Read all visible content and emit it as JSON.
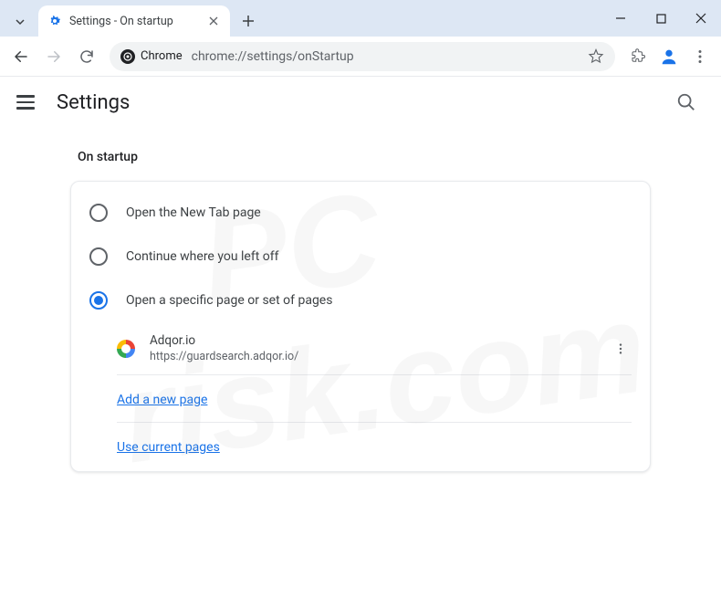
{
  "window": {
    "tab_title": "Settings - On startup"
  },
  "toolbar": {
    "chip_label": "Chrome",
    "url": "chrome://settings/onStartup"
  },
  "header": {
    "title": "Settings"
  },
  "section": {
    "title": "On startup",
    "options": [
      {
        "label": "Open the New Tab page",
        "checked": false
      },
      {
        "label": "Continue where you left off",
        "checked": false
      },
      {
        "label": "Open a specific page or set of pages",
        "checked": true
      }
    ],
    "pages": [
      {
        "name": "Adqor.io",
        "url": "https://guardsearch.adqor.io/"
      }
    ],
    "add_link": "Add a new page",
    "use_current_link": "Use current pages"
  },
  "watermark": {
    "line1": "PC",
    "line2": "risk.com"
  }
}
